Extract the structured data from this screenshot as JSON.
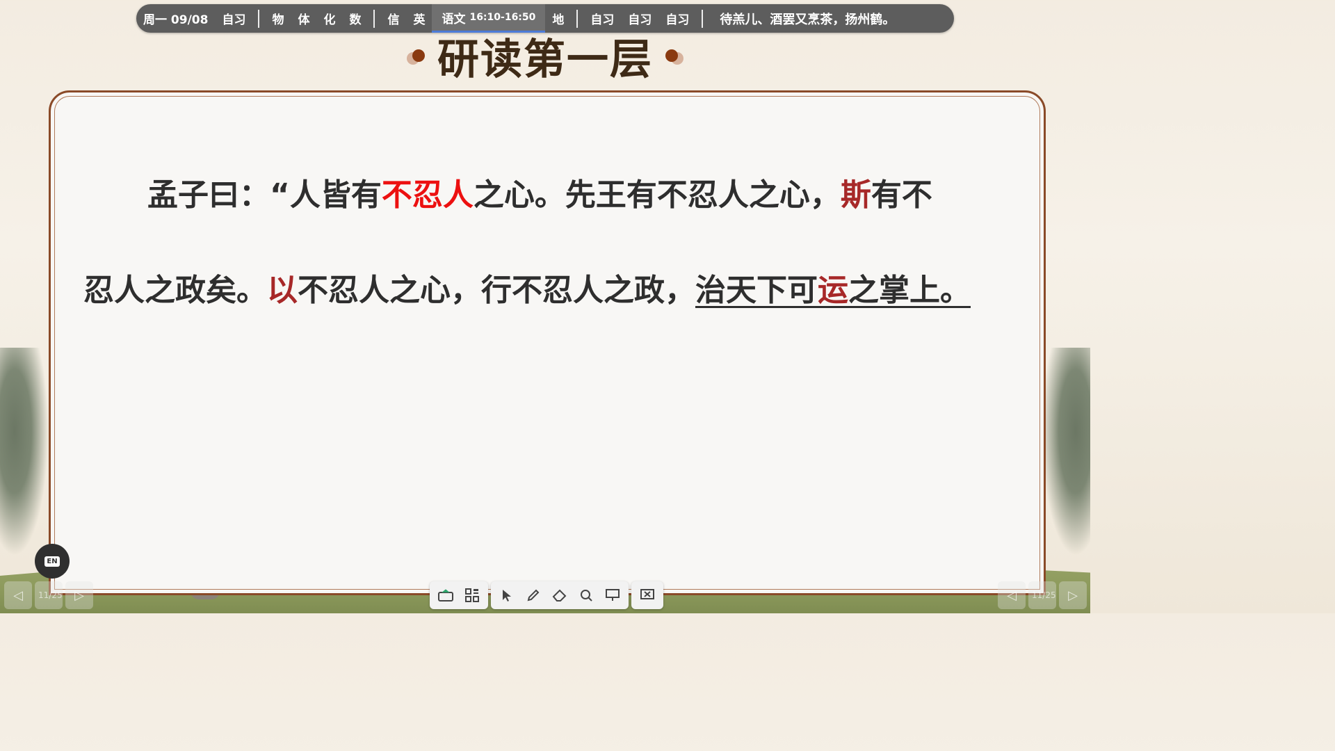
{
  "schedule": {
    "date": "周一 09/08",
    "slot1": "自习",
    "subjects1": [
      "物",
      "体",
      "化",
      "数"
    ],
    "subjects2": [
      "信",
      "英"
    ],
    "current_subject": "语文",
    "current_time": "16:10-16:50",
    "after": "地",
    "self_study": [
      "自习",
      "自习",
      "自习"
    ],
    "motto": "待羔儿、酒罢又烹茶，扬州鹤。"
  },
  "slide": {
    "title": "研读第一层",
    "line1": {
      "a": "孟子曰：“人皆有",
      "b": "不忍人",
      "c": "之心。先王有不忍人之心，",
      "d": "斯",
      "e": "有不"
    },
    "line2": {
      "a": "忍人之政矣。",
      "b": "以",
      "c": "不忍人之心，行不忍人之政，",
      "d": "治天下可",
      "e": "运",
      "f": "之掌上。"
    }
  },
  "navigation": {
    "page_left": "11/25",
    "page_right": "11/25"
  },
  "input_method": "EN"
}
